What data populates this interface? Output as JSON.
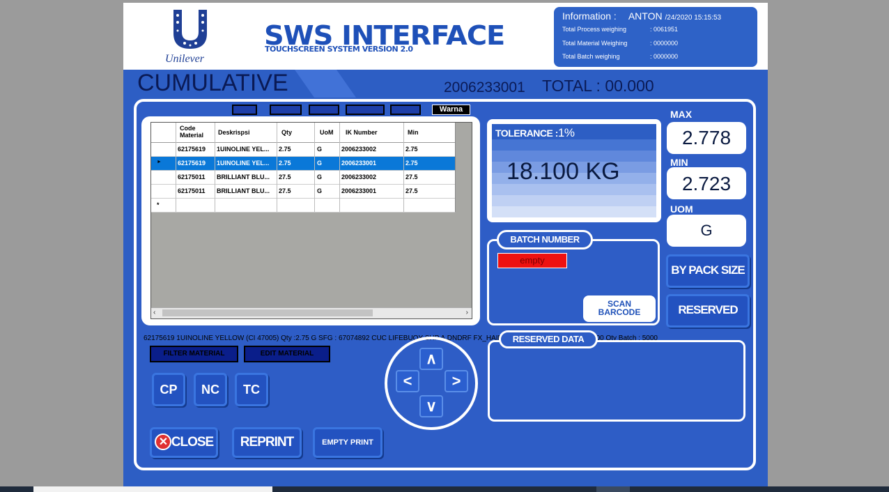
{
  "header": {
    "brand": "Unilever",
    "title": "SWS INTERFACE",
    "subtitle": "TOUCHSCREEN SYSTEM VERSION 2.0"
  },
  "info": {
    "label": "Information :",
    "user": "ANTON",
    "datetime": "/24/2020 15:15:53",
    "rows": [
      {
        "label": "Total Process weighing",
        "value": ":   0061951"
      },
      {
        "label": "Total Material Weighing",
        "value": ":   0000000"
      },
      {
        "label": "Total Batch weighing",
        "value": ":   0000000"
      }
    ]
  },
  "mode": "CUMULATIVE",
  "batch_id": "2006233001",
  "total": "TOTAL : 00.000",
  "filters": {
    "last": "Warna"
  },
  "grid": {
    "columns": [
      "Code Material",
      "Deskrispsi",
      "Qty",
      "UoM",
      "IK Number",
      "Min"
    ],
    "rows": [
      [
        "62175619",
        "1UINOLINE YEL...",
        "2.75",
        "G",
        "2006233002",
        "2.75"
      ],
      [
        "62175619",
        "1UINOLINE YEL...",
        "2.75",
        "G",
        "2006233001",
        "2.75"
      ],
      [
        "62175011",
        "BRILLIANT BLU...",
        "27.5",
        "G",
        "2006233002",
        "27.5"
      ],
      [
        "62175011",
        "BRILLIANT BLU...",
        "27.5",
        "G",
        "2006233001",
        "27.5"
      ]
    ],
    "selected_row": 1,
    "new_row_marker": "*",
    "current_row_marker": "►"
  },
  "tolerance": {
    "label": "TOLERANCE :",
    "value": "1%"
  },
  "weight": "18.100 KG",
  "max": {
    "label": "MAX",
    "value": "2.778"
  },
  "min": {
    "label": "MIN",
    "value": "2.723"
  },
  "uom": {
    "label": "UOM",
    "value": "G"
  },
  "batch": {
    "label": "BATCH NUMBER",
    "value": "empty",
    "scan_label_1": "SCAN",
    "scan_label_2": "BARCODE"
  },
  "buttons": {
    "by_pack_size": "BY PACK SIZE",
    "reserved": "RESERVED",
    "filter_material": "FILTER MATERIAL",
    "edit_material": "EDIT MATERIAL",
    "cp": "CP",
    "nc": "NC",
    "tc": "TC",
    "close": "CLOSE",
    "reprint": "REPRINT",
    "empty_print": "EMPTY PRINT"
  },
  "info_line": "62175619 1UINOLINE YELLOW (CI 47005) Qty :2.75 G SFG : 67074892 CUC LIFEBUOY SHP A.DNDRF FX_HAIRMX0 | 2006233001 m cap : 5000 Qty Batch : 5000",
  "reserved_data": {
    "label": "RESERVED DATA"
  },
  "dpad": {
    "up": "∧",
    "down": "∨",
    "left": "<",
    "right": ">"
  },
  "colors": {
    "panel": "#2e5dc6",
    "selection": "#0a78d8",
    "empty_batch": "#ee1111"
  }
}
